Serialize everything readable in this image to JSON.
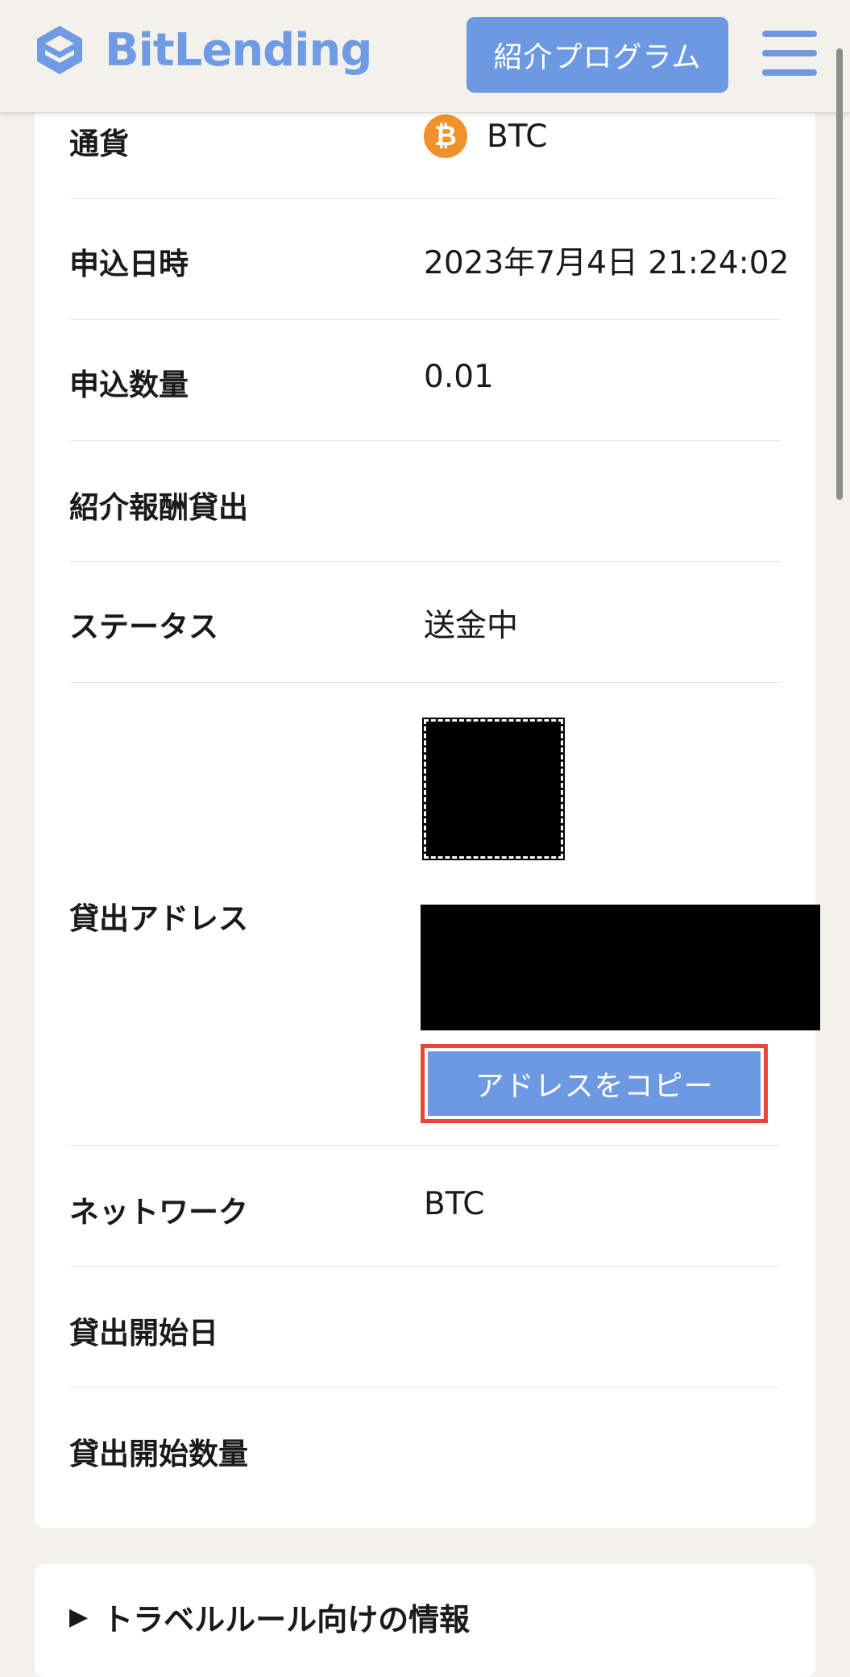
{
  "header": {
    "logo_text": "BitLending",
    "referral_label": "紹介プログラム"
  },
  "colors": {
    "brand": "#6d99e2",
    "highlight": "#e24a33",
    "bitcoin": "#f0922a"
  },
  "details": {
    "currency_label": "通貨",
    "currency_value": "BTC",
    "currency_icon": "bitcoin-icon",
    "applied_at_label": "申込日時",
    "applied_at_value": "2023年7月4日 21:24:02",
    "amount_label": "申込数量",
    "amount_value": "0.01",
    "referral_loan_label": "紹介報酬貸出",
    "status_label": "ステータス",
    "status_value": "送金中",
    "address_label": "貸出アドレス",
    "copy_button": "アドレスをコピー",
    "network_label": "ネットワーク",
    "network_value": "BTC",
    "start_date_label": "貸出開始日",
    "start_amount_label": "貸出開始数量"
  },
  "travel_rule": {
    "marker": "▶",
    "title": "トラベルルール向けの情報"
  }
}
